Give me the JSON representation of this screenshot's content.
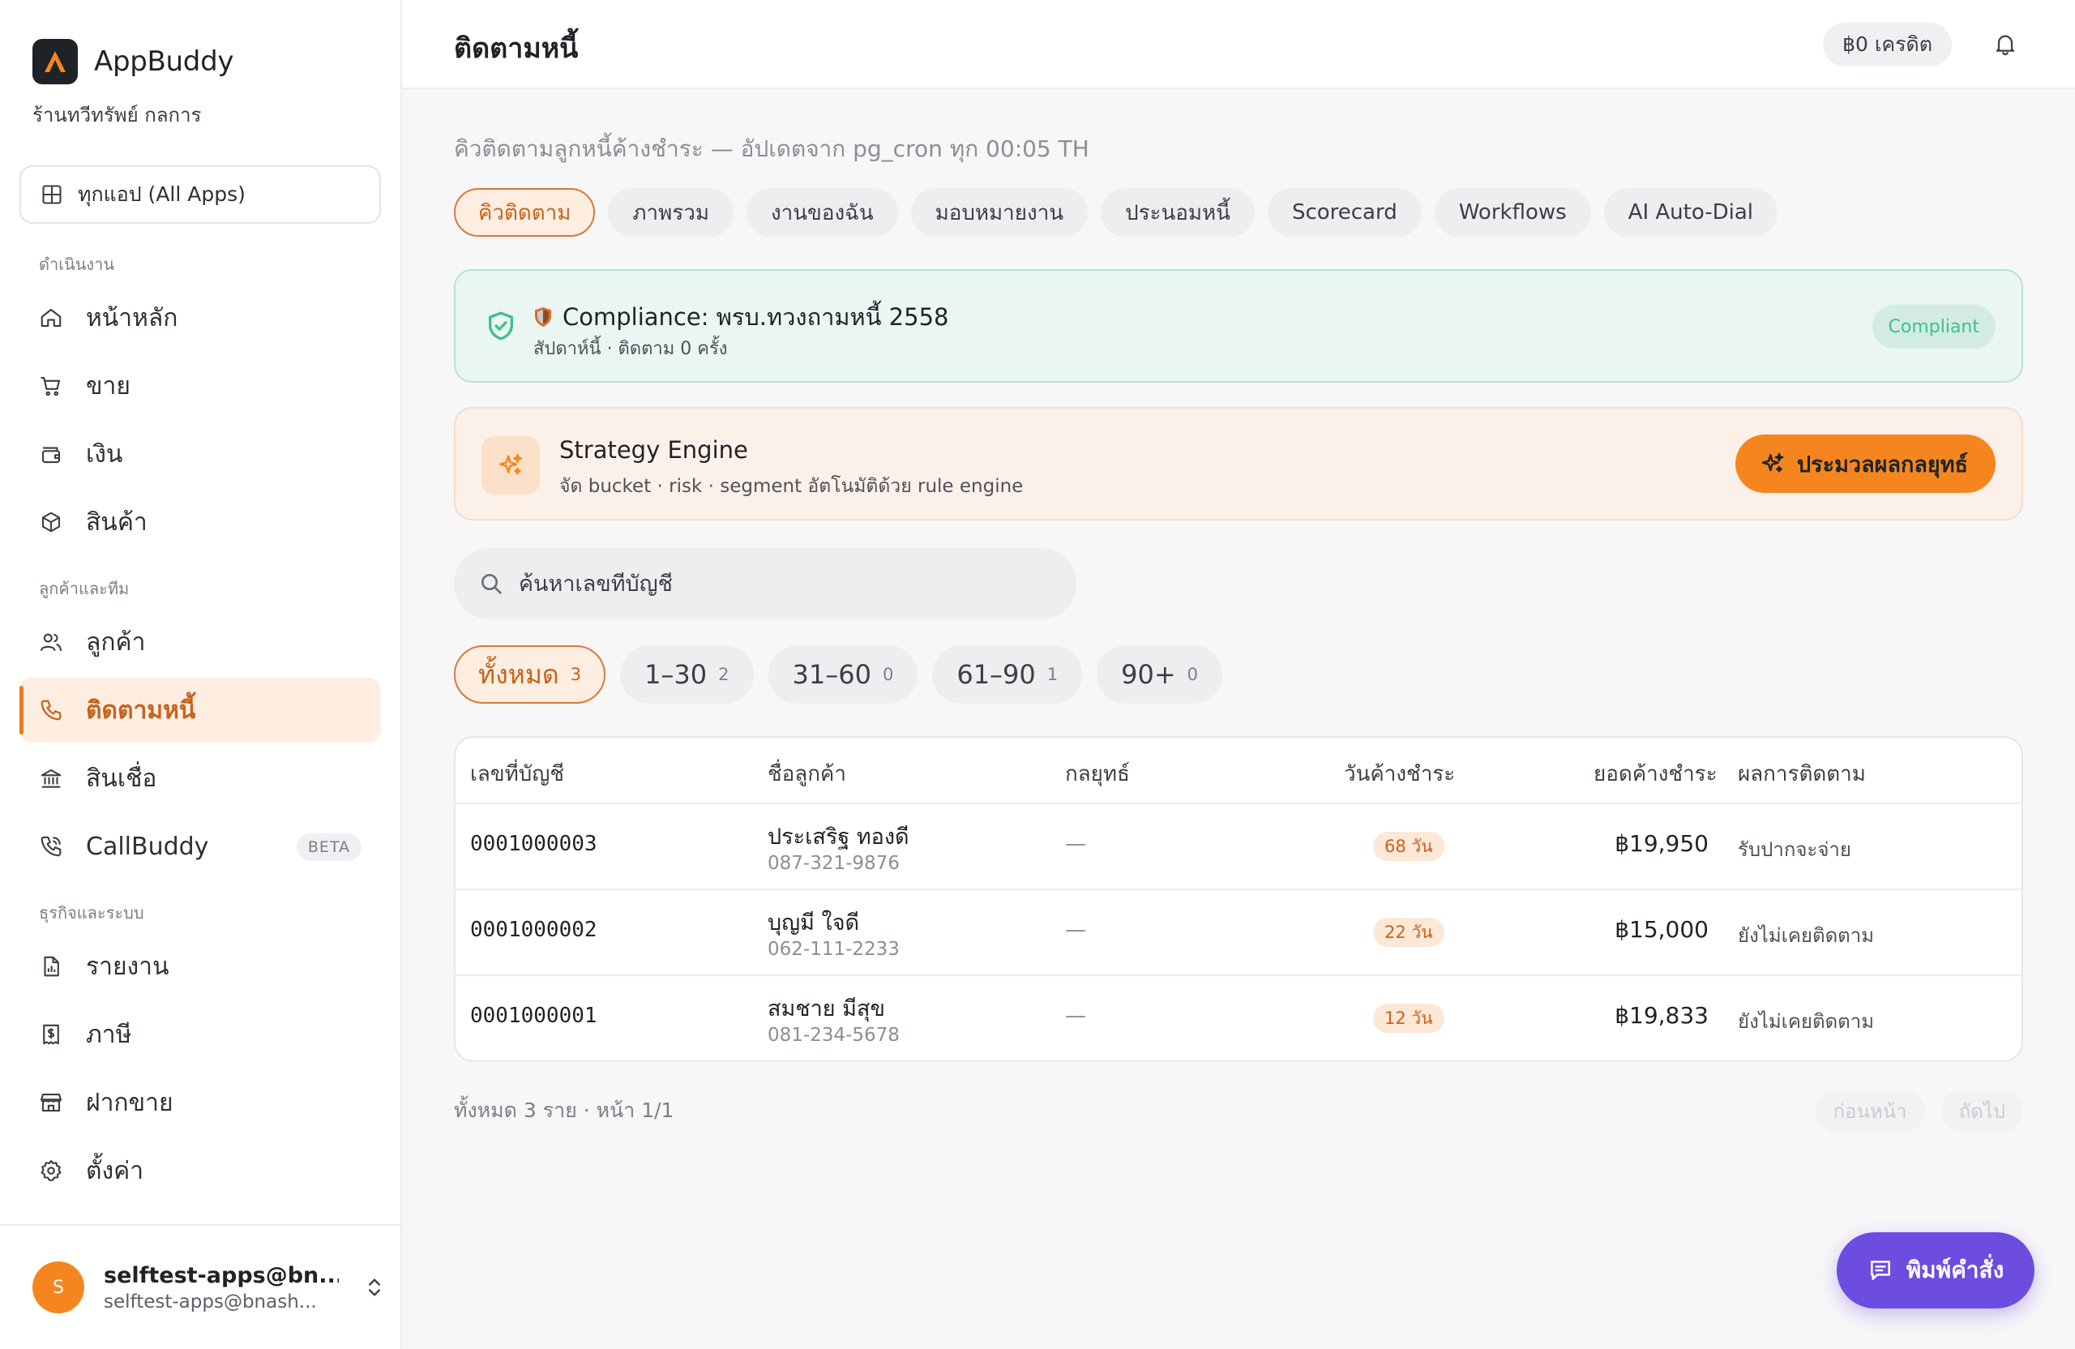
{
  "brand": {
    "name": "AppBuddy",
    "shop": "ร้านทวีทรัพย์ กลการ",
    "accent": "#f5861f"
  },
  "all_apps": {
    "label": "ทุกแอป (All Apps)"
  },
  "sections": {
    "operations": "ดำเนินงาน",
    "customers_team": "ลูกค้าและทีม",
    "business_system": "ธุรกิจและระบบ"
  },
  "nav": {
    "home": "หน้าหลัก",
    "sales": "ขาย",
    "money": "เงิน",
    "products": "สินค้า",
    "customers": "ลูกค้า",
    "debt": "ติดตามหนี้",
    "credit": "สินเชื่อ",
    "callbuddy": "CallBuddy",
    "callbuddy_badge": "BETA",
    "reports": "รายงาน",
    "tax": "ภาษี",
    "consignment": "ฝากขาย",
    "settings": "ตั้งค่า"
  },
  "user": {
    "initial": "S",
    "name": "selftest-apps@bn...",
    "email": "selftest-apps@bnash..."
  },
  "header": {
    "title": "ติดตามหนี้",
    "credit": "฿0 เครดิต"
  },
  "main": {
    "subtitle": "คิวติดตามลูกหนี้ค้างชำระ — อัปเดตจาก pg_cron ทุก 00:05 TH",
    "tabs": [
      "คิวติดตาม",
      "ภาพรวม",
      "งานของฉัน",
      "มอบหมายงาน",
      "ประนอมหนี้",
      "Scorecard",
      "Workflows",
      "AI Auto-Dial"
    ],
    "compliance": {
      "title": "Compliance: พรบ.ทวงถามหนี้ 2558",
      "subtitle": "สัปดาห์นี้ · ติดตาม 0 ครั้ง",
      "badge": "Compliant"
    },
    "strategy": {
      "title": "Strategy Engine",
      "subtitle": "จัด bucket · risk · segment อัตโนมัติด้วย rule engine",
      "button": "ประมวลผลกลยุทธ์"
    },
    "search_placeholder": "ค้นหาเลขที่บัญชี",
    "buckets": [
      {
        "label": "ทั้งหมด",
        "count": "3"
      },
      {
        "label": "1–30",
        "count": "2"
      },
      {
        "label": "31–60",
        "count": "0"
      },
      {
        "label": "61–90",
        "count": "1"
      },
      {
        "label": "90+",
        "count": "0"
      }
    ],
    "table": {
      "headers": {
        "account": "เลขที่บัญชี",
        "customer": "ชื่อลูกค้า",
        "strategy": "กลยุทธ์",
        "days": "วันค้างชำระ",
        "amount": "ยอดค้างชำระ",
        "result": "ผลการติดตาม"
      },
      "rows": [
        {
          "account": "0001000003",
          "name": "ประเสริฐ ทองดี",
          "phone": "087-321-9876",
          "strategy": "—",
          "days": "68 วัน",
          "amount": "฿19,950",
          "result": "รับปากจะจ่าย"
        },
        {
          "account": "0001000002",
          "name": "บุญมี ใจดี",
          "phone": "062-111-2233",
          "strategy": "—",
          "days": "22 วัน",
          "amount": "฿15,000",
          "result": "ยังไม่เคยติดตาม"
        },
        {
          "account": "0001000001",
          "name": "สมชาย มีสุข",
          "phone": "081-234-5678",
          "strategy": "—",
          "days": "12 วัน",
          "amount": "฿19,833",
          "result": "ยังไม่เคยติดตาม"
        }
      ]
    },
    "summary": "ทั้งหมด 3 ราย · หน้า 1/1",
    "pager": {
      "prev": "ก่อนหน้า",
      "next": "ถัดไป"
    }
  },
  "command_button": "พิมพ์คำสั่ง"
}
